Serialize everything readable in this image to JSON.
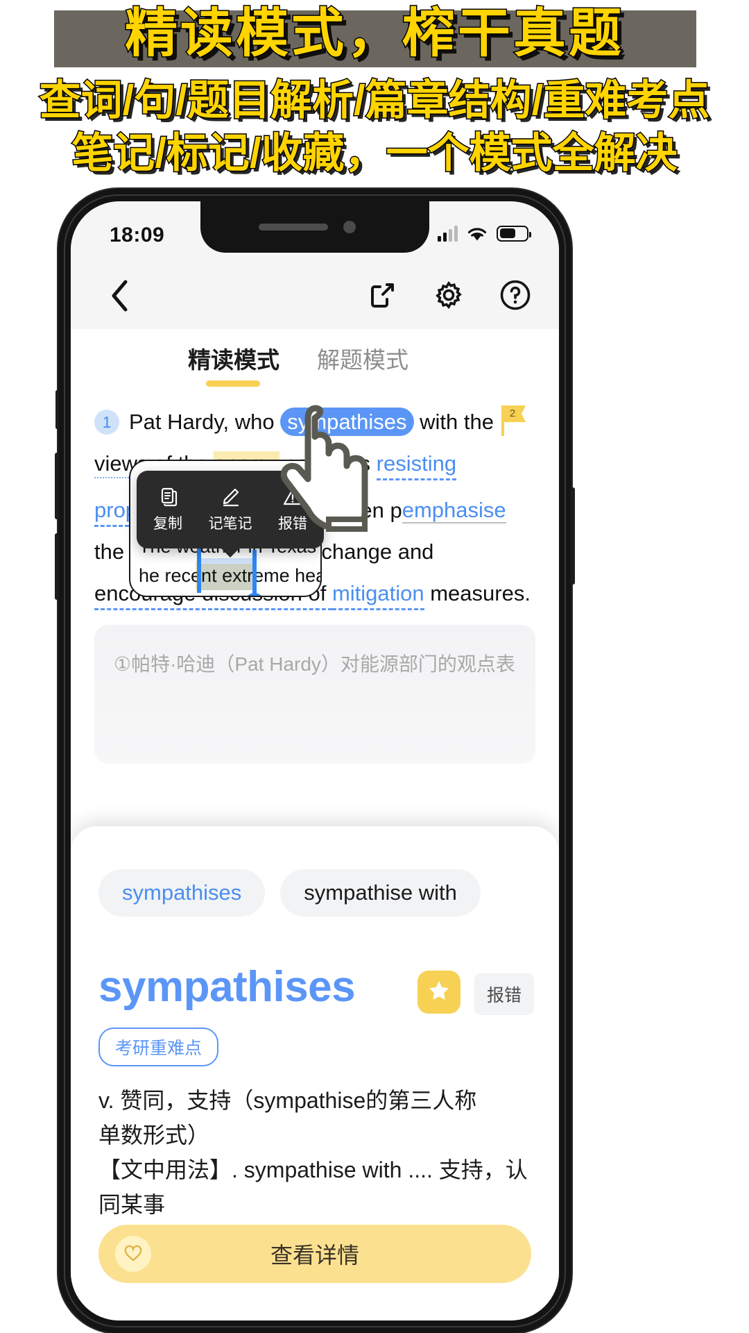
{
  "promo": {
    "line1": "精读模式，榨干真题",
    "line2": "查词/句/题目解析/篇章结构/重难考点",
    "line3": "笔记/标记/收藏，一个模式全解决",
    "band_color": "#6b675f",
    "text_color": "#FFD400"
  },
  "status_bar": {
    "time": "18:09",
    "signal_icon": "cellular-signal-icon",
    "wifi_icon": "wifi-icon",
    "battery_icon": "battery-icon"
  },
  "navbar": {
    "back_icon": "chevron-left-icon",
    "share_icon": "share-icon",
    "settings_icon": "gear-icon",
    "help_icon": "question-circle-icon"
  },
  "tabs": {
    "active": "精读模式",
    "inactive": "解题模式",
    "accent_color": "#F7D154"
  },
  "article": {
    "marker": "1",
    "t1": "Pat Hardy, who ",
    "selected_word": "sympathises",
    "t2": " with the ",
    "views": "views",
    "t3": "of the ",
    "energy": "energy",
    "t4": " sector, is ",
    "resisting": "resisting proposed",
    "sup1": "2",
    "t5": "ci",
    "t5b": "dards for pre-teen",
    "t6": "p",
    "t6b": "emphasise",
    "t7": " the primacy",
    "t8": "o",
    "t8b": "nt climate change and",
    "t9": "encourage discussion of ",
    "mitigation": "mitigation",
    "t10": " measures.",
    "flag_num": "2"
  },
  "translation_ghost": "①帕特·哈迪（Pat Hardy）对能源部门的观点表",
  "context_menu": {
    "items": [
      {
        "label": "复制",
        "icon": "copy-icon"
      },
      {
        "label": "记笔记",
        "icon": "pencil-icon"
      },
      {
        "label": "报错",
        "icon": "warning-triangle-icon"
      }
    ]
  },
  "selection_tooltip": {
    "line1": "The weather in Texas may ha",
    "line2_before": "he recent ",
    "line2_sel": "extreme",
    "line2_after": " heat, but t"
  },
  "dict_sheet": {
    "chips": [
      {
        "label": "sympathises",
        "active": true
      },
      {
        "label": "sympathise with",
        "active": false
      }
    ],
    "headword": "sympathises",
    "headword_color": "#5B96F7",
    "star_icon": "star-icon",
    "report_label": "报错",
    "tag": "考研重难点",
    "definition_line1": "v. 赞同，支持（sympathise的第三人称",
    "definition_line2": "单数形式）",
    "definition_line3": "【文中用法】. sympathise with .... 支持，认",
    "definition_line4": "同某事",
    "cta_label": "查看详情",
    "cta_badge_icon": "heart-badge-icon",
    "cta_color": "#FBE08F"
  }
}
